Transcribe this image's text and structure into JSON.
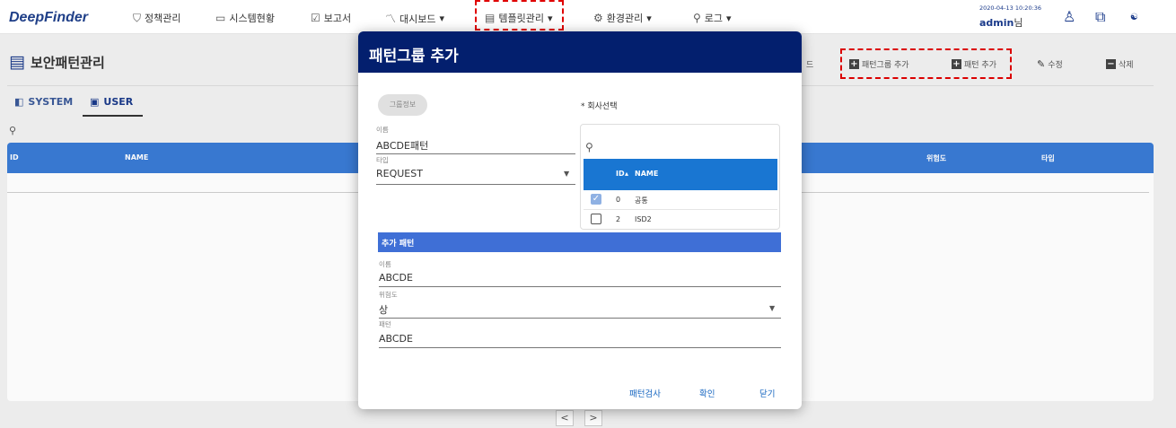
{
  "app": {
    "logo": "DeepFinder",
    "nav": [
      {
        "label": "정책관리",
        "icon": "shield-icon",
        "glyph": "⛉",
        "has_dropdown": false
      },
      {
        "label": "시스템현황",
        "icon": "monitor-icon",
        "glyph": "▭",
        "has_dropdown": false
      },
      {
        "label": "보고서",
        "icon": "report-icon",
        "glyph": "☑",
        "has_dropdown": false
      },
      {
        "label": "대시보드",
        "icon": "chart-icon",
        "glyph": "〽",
        "has_dropdown": true
      },
      {
        "label": "템플릿관리",
        "icon": "template-icon",
        "glyph": "▤",
        "has_dropdown": true
      },
      {
        "label": "환경관리",
        "icon": "gear-icon",
        "glyph": "⚙",
        "has_dropdown": true
      },
      {
        "label": "로그",
        "icon": "search-icon",
        "glyph": "⚲",
        "has_dropdown": true
      }
    ],
    "datetime": "2020-04-13 10:20:36",
    "user": "admin",
    "user_suffix": "님"
  },
  "page": {
    "title": "보안패턴관리",
    "tabs": [
      {
        "label": "SYSTEM",
        "icon": "system-icon",
        "active": false
      },
      {
        "label": "USER",
        "icon": "user-list-icon",
        "active": true
      }
    ],
    "actions": {
      "partial_hidden": "드",
      "add_group": "패턴그룹 추가",
      "add_pattern": "패턴 추가",
      "edit": "수정",
      "delete": "삭제"
    },
    "table_headers": {
      "id": "ID",
      "name": "NAME",
      "risk": "위험도",
      "type": "타입"
    },
    "pager": {
      "prev": "<",
      "next": ">"
    }
  },
  "modal": {
    "title": "패턴그룹 추가",
    "group_chip": "그룹정보",
    "name_label": "이름",
    "name_value": "ABCDE패턴",
    "type_label": "타입",
    "type_value": "REQUEST",
    "company_label": "* 회사선택",
    "company_table": {
      "headers": {
        "id": "ID",
        "name": "NAME"
      },
      "rows": [
        {
          "id": "0",
          "name": "공통",
          "checked": true
        },
        {
          "id": "2",
          "name": "ISD2",
          "checked": false
        }
      ]
    },
    "section": "추가 패턴",
    "pattern_name_label": "이름",
    "pattern_name_value": "ABCDE",
    "risk_label": "위험도",
    "risk_value": "상",
    "pattern_label": "패턴",
    "pattern_value": "ABCDE",
    "buttons": {
      "check": "패턴검사",
      "ok": "확인",
      "close": "닫기"
    }
  },
  "colors": {
    "nav_accent": "#1a3a8a",
    "modal_header": "#031f6e",
    "table_header": "#3a7bd5",
    "section_bar": "#3f6fd6",
    "highlight": "#e00000"
  }
}
